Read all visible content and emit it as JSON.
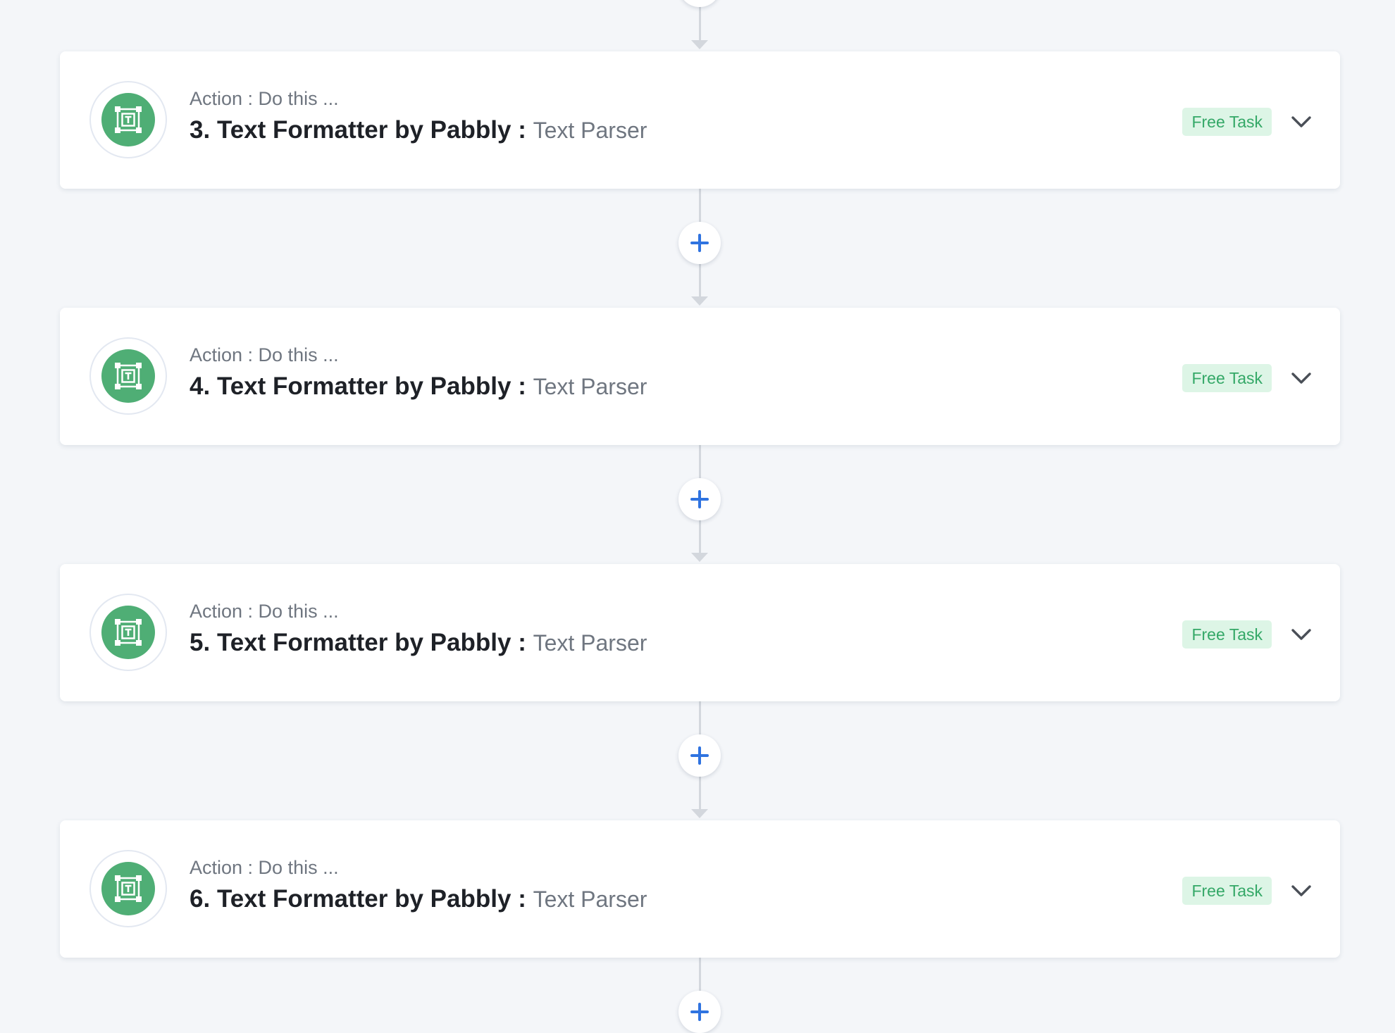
{
  "colors": {
    "background": "#f4f6f9",
    "card": "#ffffff",
    "app_icon": "#4fae75",
    "badge_bg": "#ddf5e6",
    "badge_text": "#34a867",
    "plus": "#2f73e0",
    "connector": "#d3d7dd"
  },
  "icons": {
    "add_step": "plus-icon",
    "app": "text-formatter-icon",
    "expand": "chevron-down-icon"
  },
  "steps": [
    {
      "subtitle": "Action : Do this ...",
      "number": "3.",
      "app_name": "Text Formatter by Pabbly",
      "separator": ":",
      "action_name": "Text Parser",
      "badge": "Free Task"
    },
    {
      "subtitle": "Action : Do this ...",
      "number": "4.",
      "app_name": "Text Formatter by Pabbly",
      "separator": ":",
      "action_name": "Text Parser",
      "badge": "Free Task"
    },
    {
      "subtitle": "Action : Do this ...",
      "number": "5.",
      "app_name": "Text Formatter by Pabbly",
      "separator": ":",
      "action_name": "Text Parser",
      "badge": "Free Task"
    },
    {
      "subtitle": "Action : Do this ...",
      "number": "6.",
      "app_name": "Text Formatter by Pabbly",
      "separator": ":",
      "action_name": "Text Parser",
      "badge": "Free Task"
    }
  ]
}
